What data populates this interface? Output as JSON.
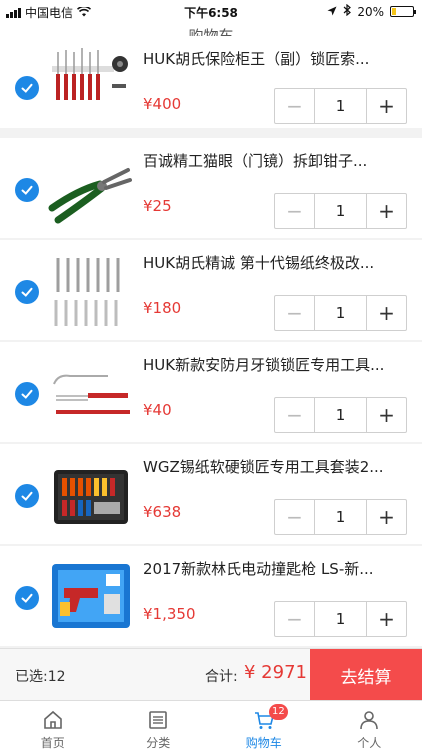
{
  "status_bar": {
    "carrier": "中国电信",
    "time": "下午6:58",
    "battery_percent": "20%",
    "battery_level": 0.2
  },
  "navbar": {
    "title": "购物车"
  },
  "cart": {
    "items": [
      {
        "name": "HUK胡氏保险柜王（副）锁匠索...",
        "price": "¥400",
        "quantity": "1",
        "selected": true,
        "image_icon": "lock-pick-set-icon"
      },
      {
        "name": "百诚精工猫眼（门镜）拆卸钳子...",
        "price": "¥25",
        "quantity": "1",
        "selected": true,
        "image_icon": "pliers-icon"
      },
      {
        "name": "HUK胡氏精诚 第十代锡纸终极改...",
        "price": "¥180",
        "quantity": "1",
        "selected": true,
        "image_icon": "tin-foil-tool-set-icon"
      },
      {
        "name": "HUK新款安防月牙锁锁匠专用工具...",
        "price": "¥40",
        "quantity": "1",
        "selected": true,
        "image_icon": "tension-tool-icon"
      },
      {
        "name": "WGZ锡纸软硬锁匠专用工具套装2...",
        "price": "¥638",
        "quantity": "1",
        "selected": true,
        "image_icon": "tool-case-icon"
      },
      {
        "name": "2017新款林氏电动撞匙枪 LS-新...",
        "price": "¥1,350",
        "quantity": "1",
        "selected": true,
        "image_icon": "electric-pick-gun-case-icon"
      }
    ],
    "minus_label": "−",
    "plus_label": "+"
  },
  "summary": {
    "selected_label": "已选:12",
    "total_label": "合计:",
    "total_value": "¥ 2971",
    "checkout_label": "去结算"
  },
  "tabbar": {
    "tabs": [
      {
        "label": "首页",
        "icon": "home-icon"
      },
      {
        "label": "分类",
        "icon": "category-icon"
      },
      {
        "label": "购物车",
        "icon": "cart-icon",
        "badge": "12",
        "active": true
      },
      {
        "label": "个人",
        "icon": "person-icon"
      }
    ]
  },
  "colors": {
    "accent": "#1e88e5",
    "price": "#e53935",
    "checkout": "#f44b4b"
  }
}
